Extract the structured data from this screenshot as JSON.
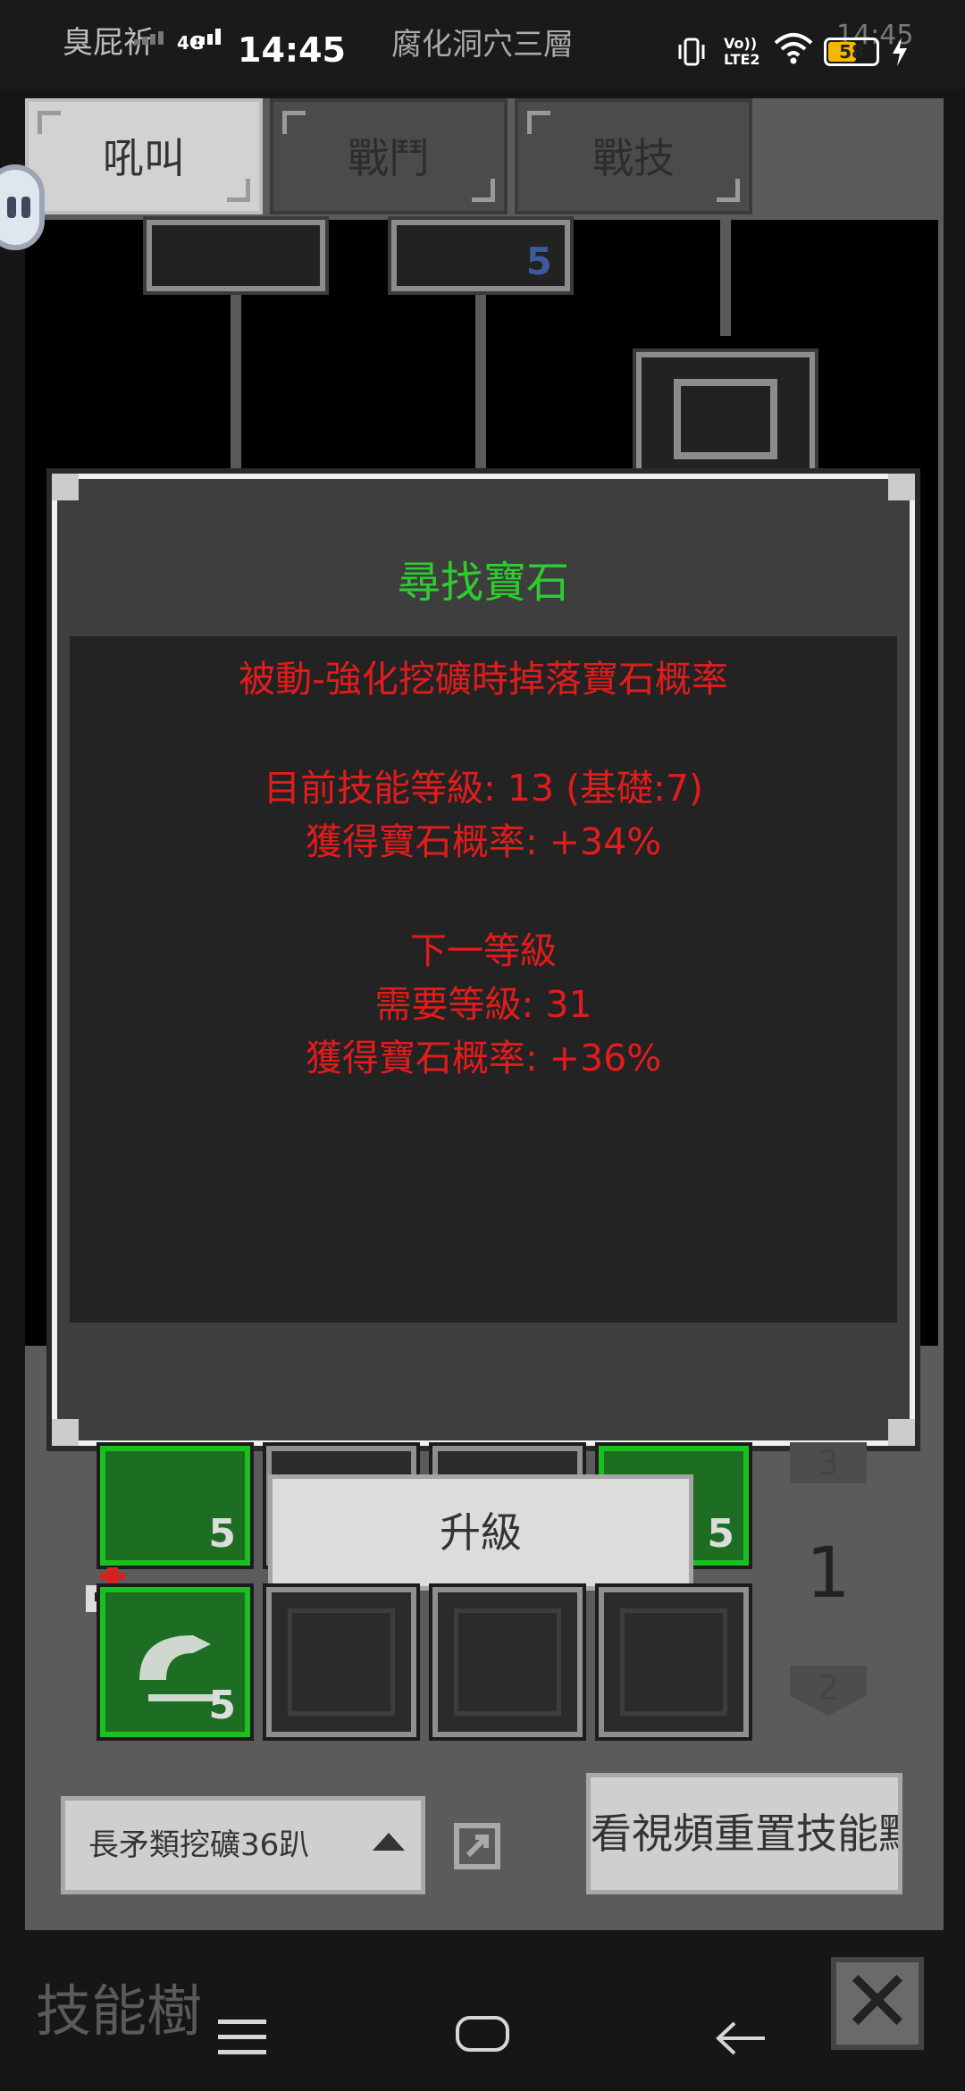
{
  "statusbar": {
    "carrier": "臭屁祈",
    "network": "4G",
    "time": "14:45",
    "app_title": "腐化洞穴三層",
    "right_time": "14:45",
    "volte": "Vo)) LTE2",
    "battery": "58"
  },
  "tabs": [
    {
      "label": "吼叫",
      "active": true
    },
    {
      "label": "戰鬥",
      "active": false
    },
    {
      "label": "戰技",
      "active": false
    }
  ],
  "tree": {
    "node_count_label": "5"
  },
  "dialog": {
    "title": "尋找寶石",
    "lines": [
      "被動-強化挖礦時掉落寶石概率",
      "目前技能等級: 13 (基礎:7)",
      "獲得寶石概率: +34%",
      "下一等級",
      "需要等級: 31",
      "獲得寶石概率: +36%"
    ],
    "title_color": "#2ecc2e",
    "text_color": "#e21c1c"
  },
  "grid": {
    "row1_levels": [
      "5",
      "5"
    ],
    "row2_level": "5",
    "upgrade_label": "升級",
    "page_up": "3",
    "page_current": "1",
    "page_down": "2"
  },
  "footer": {
    "dropdown_label": "長矛類挖礦36趴",
    "reset_label": "看視頻重置技能點",
    "title": "技能樹",
    "close_label": "✕"
  },
  "icons": [
    "vibrate-icon",
    "wifi-icon",
    "battery-icon",
    "charging-icon",
    "share-icon",
    "menu-icon",
    "home-icon",
    "back-icon",
    "close-icon",
    "skull-icon"
  ]
}
